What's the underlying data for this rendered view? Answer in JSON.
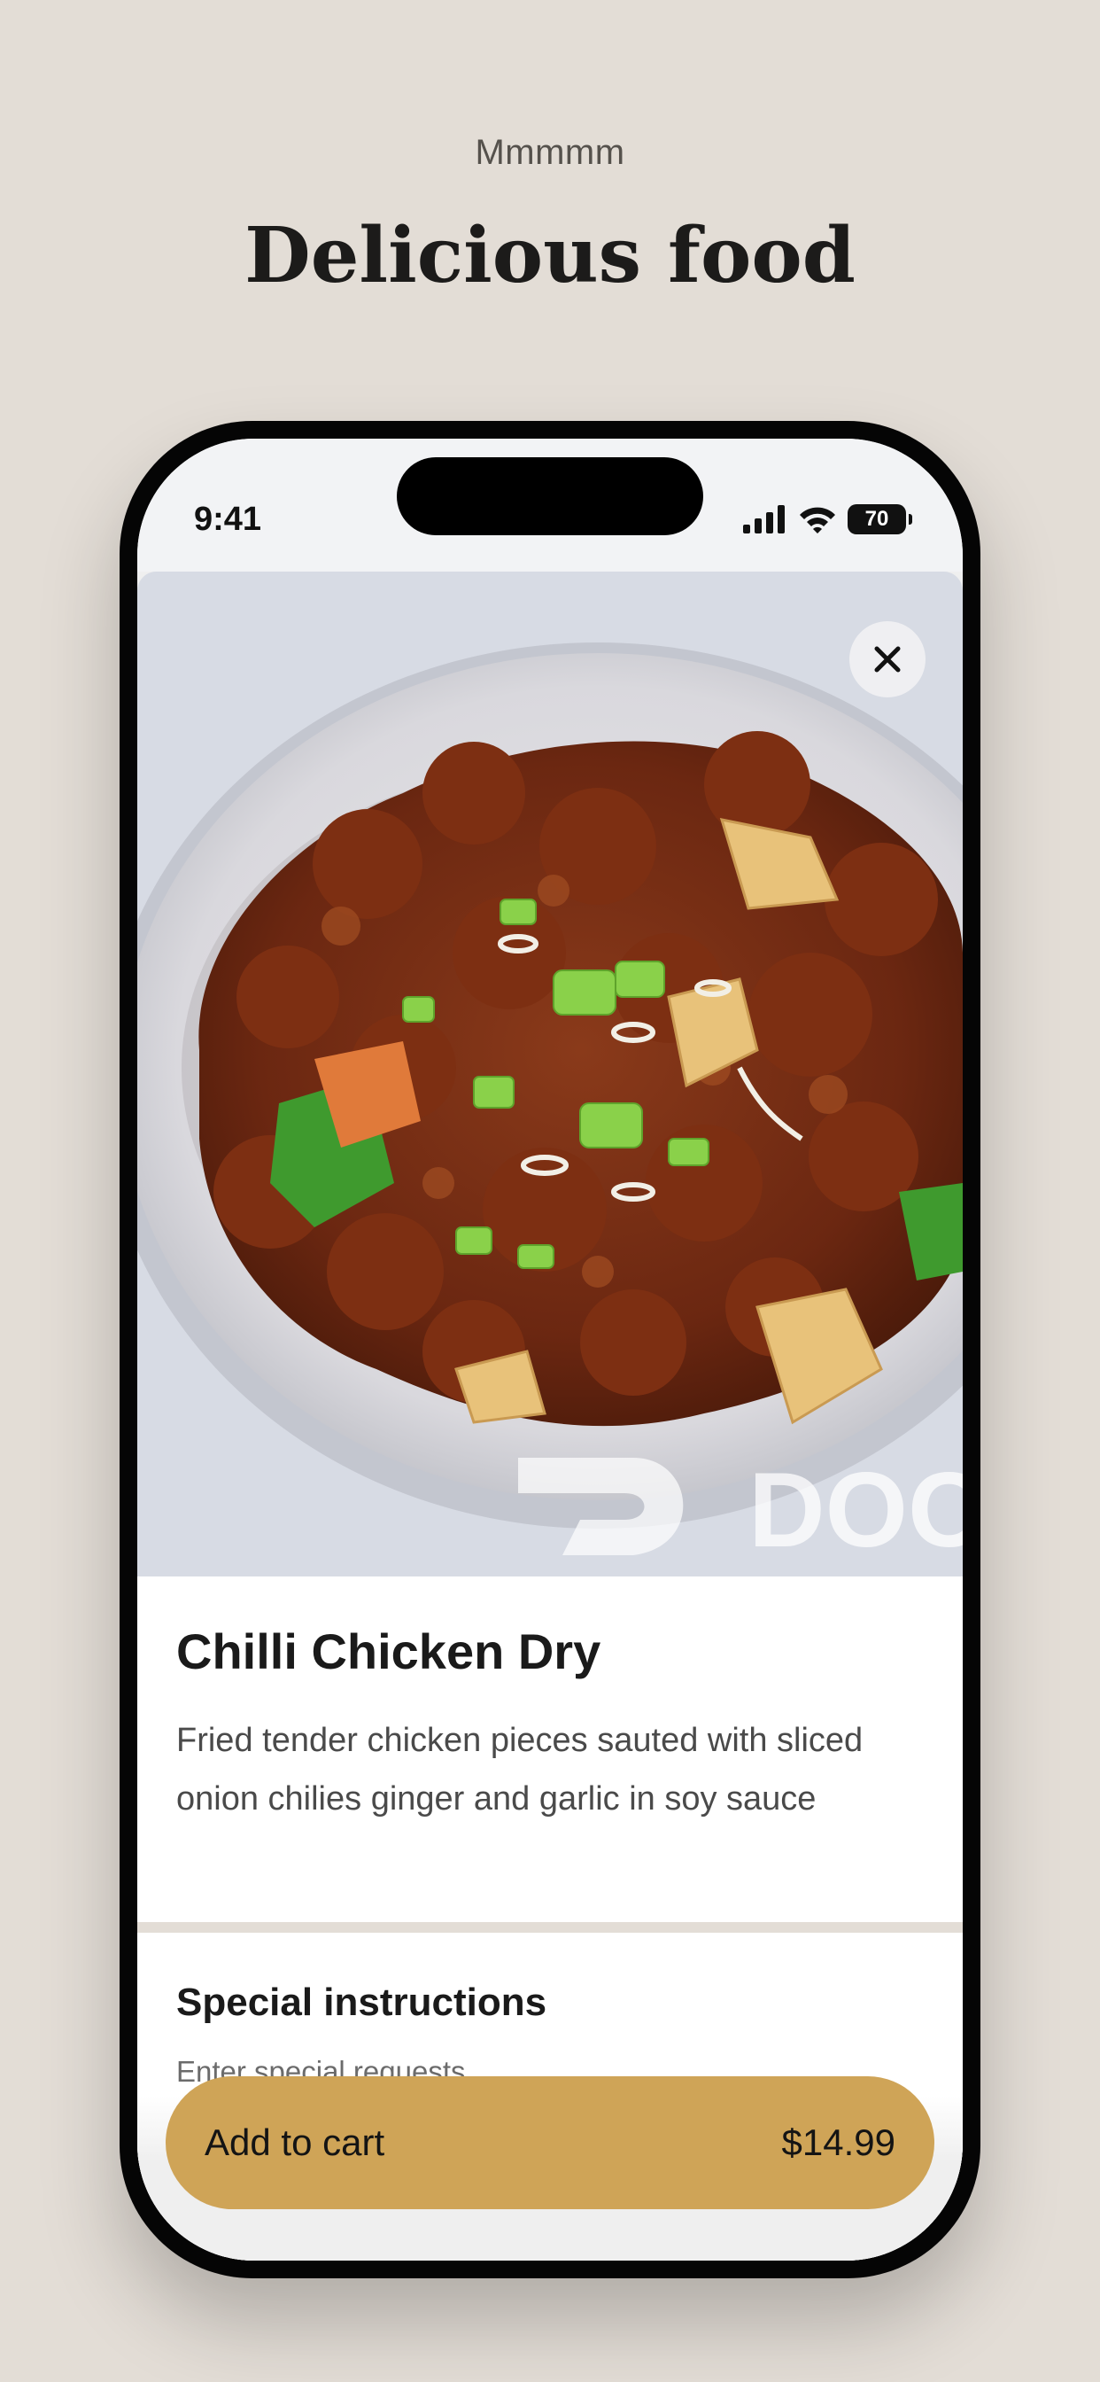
{
  "promo": {
    "eyebrow": "Mmmmm",
    "headline": "Delicious food"
  },
  "status_bar": {
    "time": "9:41",
    "battery": "70",
    "icons": [
      "signal-icon",
      "wifi-icon",
      "battery-icon"
    ]
  },
  "hero": {
    "image": "chilli-chicken-dry-photo",
    "watermark": "DOO"
  },
  "item": {
    "title": "Chilli Chicken Dry",
    "description": "Fried tender chicken pieces sauted with sliced onion chilies ginger and garlic in soy sauce"
  },
  "special_instructions": {
    "title": "Special instructions",
    "placeholder": "Enter special requests"
  },
  "cart_button": {
    "label": "Add to cart",
    "price": "$14.99",
    "color": "#cfa457"
  },
  "colors": {
    "background": "#e3ddd6",
    "accent": "#cfa457"
  }
}
